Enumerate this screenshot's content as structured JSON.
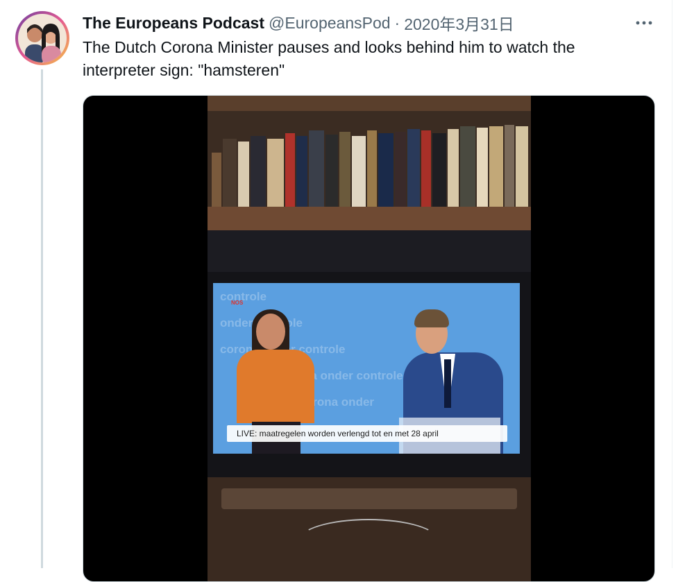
{
  "tweet": {
    "display_name": "The Europeans Podcast",
    "handle": "@EuropeansPod",
    "separator": "·",
    "date": "2020年3月31日",
    "more_icon": "more-horizontal-icon",
    "text": "The Dutch Corona Minister pauses and looks behind him to watch the interpreter sign: \"hamsteren\""
  },
  "video": {
    "caption": "LIVE: maatregelen worden verlengd tot en met 28 april",
    "logo_text": "NOS",
    "background_words": [
      "controle",
      "onder controle",
      "corona onder controle",
      "na onder controle",
      "we corona onder"
    ]
  },
  "colors": {
    "text_primary": "#0f1419",
    "text_secondary": "#536471",
    "border": "#cfd9de",
    "screen_blue": "#5b9fe0",
    "interpreter_orange": "#e07a2c"
  }
}
